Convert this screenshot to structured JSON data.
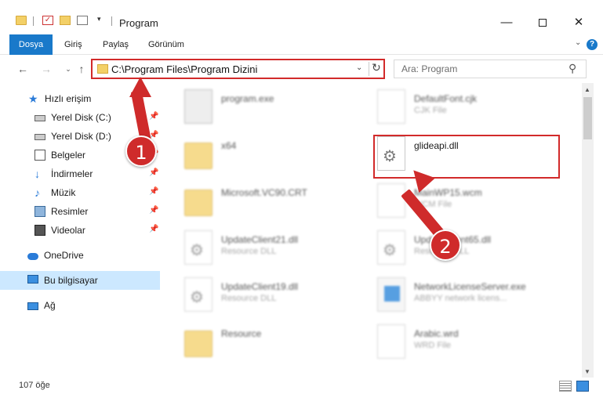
{
  "window": {
    "title": "Program",
    "minimize": "—",
    "close": "✕"
  },
  "ribbon": {
    "tabs": [
      "Dosya",
      "Giriş",
      "Paylaş",
      "Görünüm"
    ],
    "expand": "⌄",
    "help": "?"
  },
  "nav": {
    "back": "←",
    "forward": "→",
    "recent": "⌄",
    "up": "↑",
    "address": "C:\\Program Files\\Program Dizini",
    "address_dropdown": "⌄",
    "refresh": "↻",
    "search_placeholder": "Ara: Program",
    "search_icon": "⚲"
  },
  "sidebar": {
    "items": [
      {
        "label": "Hızlı erişim",
        "icon": "star-icon"
      },
      {
        "label": "Yerel Disk (C:)",
        "icon": "disk-icon"
      },
      {
        "label": "Yerel Disk (D:)",
        "icon": "disk-icon"
      },
      {
        "label": "Belgeler",
        "icon": "documents-icon"
      },
      {
        "label": "İndirmeler",
        "icon": "download-icon"
      },
      {
        "label": "Müzik",
        "icon": "music-icon"
      },
      {
        "label": "Resimler",
        "icon": "pictures-icon"
      },
      {
        "label": "Videolar",
        "icon": "videos-icon"
      },
      {
        "label": "OneDrive",
        "icon": "cloud-icon"
      },
      {
        "label": "Bu bilgisayar",
        "icon": "computer-icon"
      },
      {
        "label": "Ağ",
        "icon": "network-icon"
      }
    ],
    "pin": "📌"
  },
  "files": [
    {
      "name": "program.exe",
      "type": ""
    },
    {
      "name": "DefaultFont.cjk",
      "type": "CJK File"
    },
    {
      "name": "x64",
      "type": ""
    },
    {
      "name": "glideapi.dll",
      "type": ""
    },
    {
      "name": "Microsoft.VC90.CRT",
      "type": ""
    },
    {
      "name": "MainWP15.wcm",
      "type": "WCM File"
    },
    {
      "name": "UpdateClient21.dll",
      "type": "Resource DLL"
    },
    {
      "name": "UpdateClient65.dll",
      "type": "Resource DLL"
    },
    {
      "name": "UpdateClient19.dll",
      "type": "Resource DLL"
    },
    {
      "name": "NetworkLicenseServer.exe",
      "type": "ABBYY network licens..."
    },
    {
      "name": "Resource",
      "type": ""
    },
    {
      "name": "Arabic.wrd",
      "type": "WRD File"
    }
  ],
  "callouts": [
    "1",
    "2"
  ],
  "status": {
    "count": "107 öğe"
  },
  "colors": {
    "accent": "#1979ca",
    "highlight": "#d22a2a",
    "selected": "#cce8ff"
  }
}
